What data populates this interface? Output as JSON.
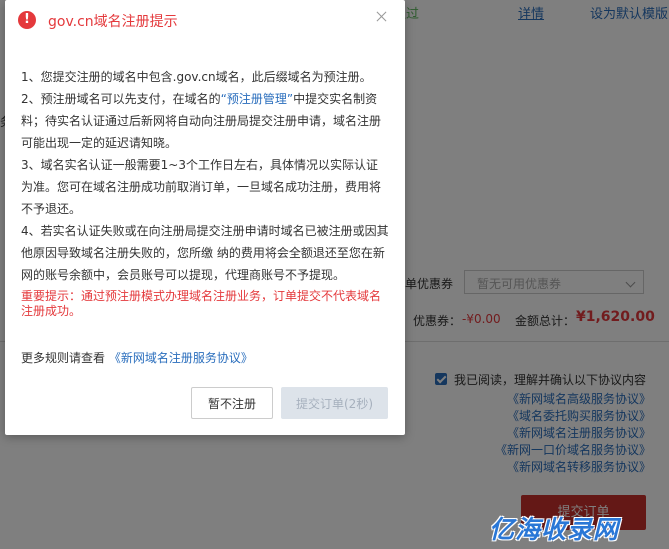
{
  "background": {
    "status": "核通过",
    "detail_link": "详情",
    "default_template_link": "设为默认模版",
    "edge_char": "务",
    "coupon_label": "单优惠券",
    "coupon_select_placeholder": "暂无可用优惠券",
    "coupon_amount_label": "优惠券：",
    "coupon_amount": "-¥0.00",
    "total_label": "金额总计：",
    "total": "¥1,620.00",
    "agree_text": "我已阅读，理解并确认以下协议内容",
    "protocols": [
      "《新网域名高级服务协议》",
      "《域名委托购买服务协议》",
      "《新网域名注册服务协议》",
      "《新网一口价域名服务协议》",
      "《新网域名转移服务协议》"
    ],
    "submit_button": "提交订单",
    "watermark": "亿海收录网"
  },
  "dialog": {
    "title": "gov.cn域名注册提示",
    "icon": "exclamation-circle-icon",
    "items": {
      "p1": "1、您提交注册的域名中包含.gov.cn域名，此后缀域名为预注册。",
      "p2_a": "2、预注册域名可以先支付，在域名的",
      "p2_link": "“预注册管理”",
      "p2_b": "中提交实名制资料；待实名认证通过后新网将自动向注册局提交注册申请，域名注册可能出现一定的延迟请知晓。",
      "p3": "3、域名实名认证一般需要1~3个工作日左右，具体情况以实际认证为准。您可在域名注册成功前取消订单，一旦域名成功注册，费用将不予退还。",
      "p4": "4、若实名认证失败或在向注册局提交注册申请时域名已被注册或因其他原因导致域名注册失败的，您所缴 纳的费用将会全额退还至您在新网的账号余额中，会员账号可以提现，代理商账号不予提现。",
      "important": "重要提示：通过预注册模式办理域名注册业务，订单提交不代表域名注册成功。",
      "more_prefix": "更多规则请查看",
      "more_link": "《新网域名注册服务协议》"
    },
    "cancel_button": "暂不注册",
    "submit_button": "提交订单(2秒)"
  },
  "colors": {
    "accent_red": "#e4393c",
    "link_blue": "#2a6ebd",
    "success_green": "#5cb85c",
    "disabled_bg": "#dde3ea"
  }
}
